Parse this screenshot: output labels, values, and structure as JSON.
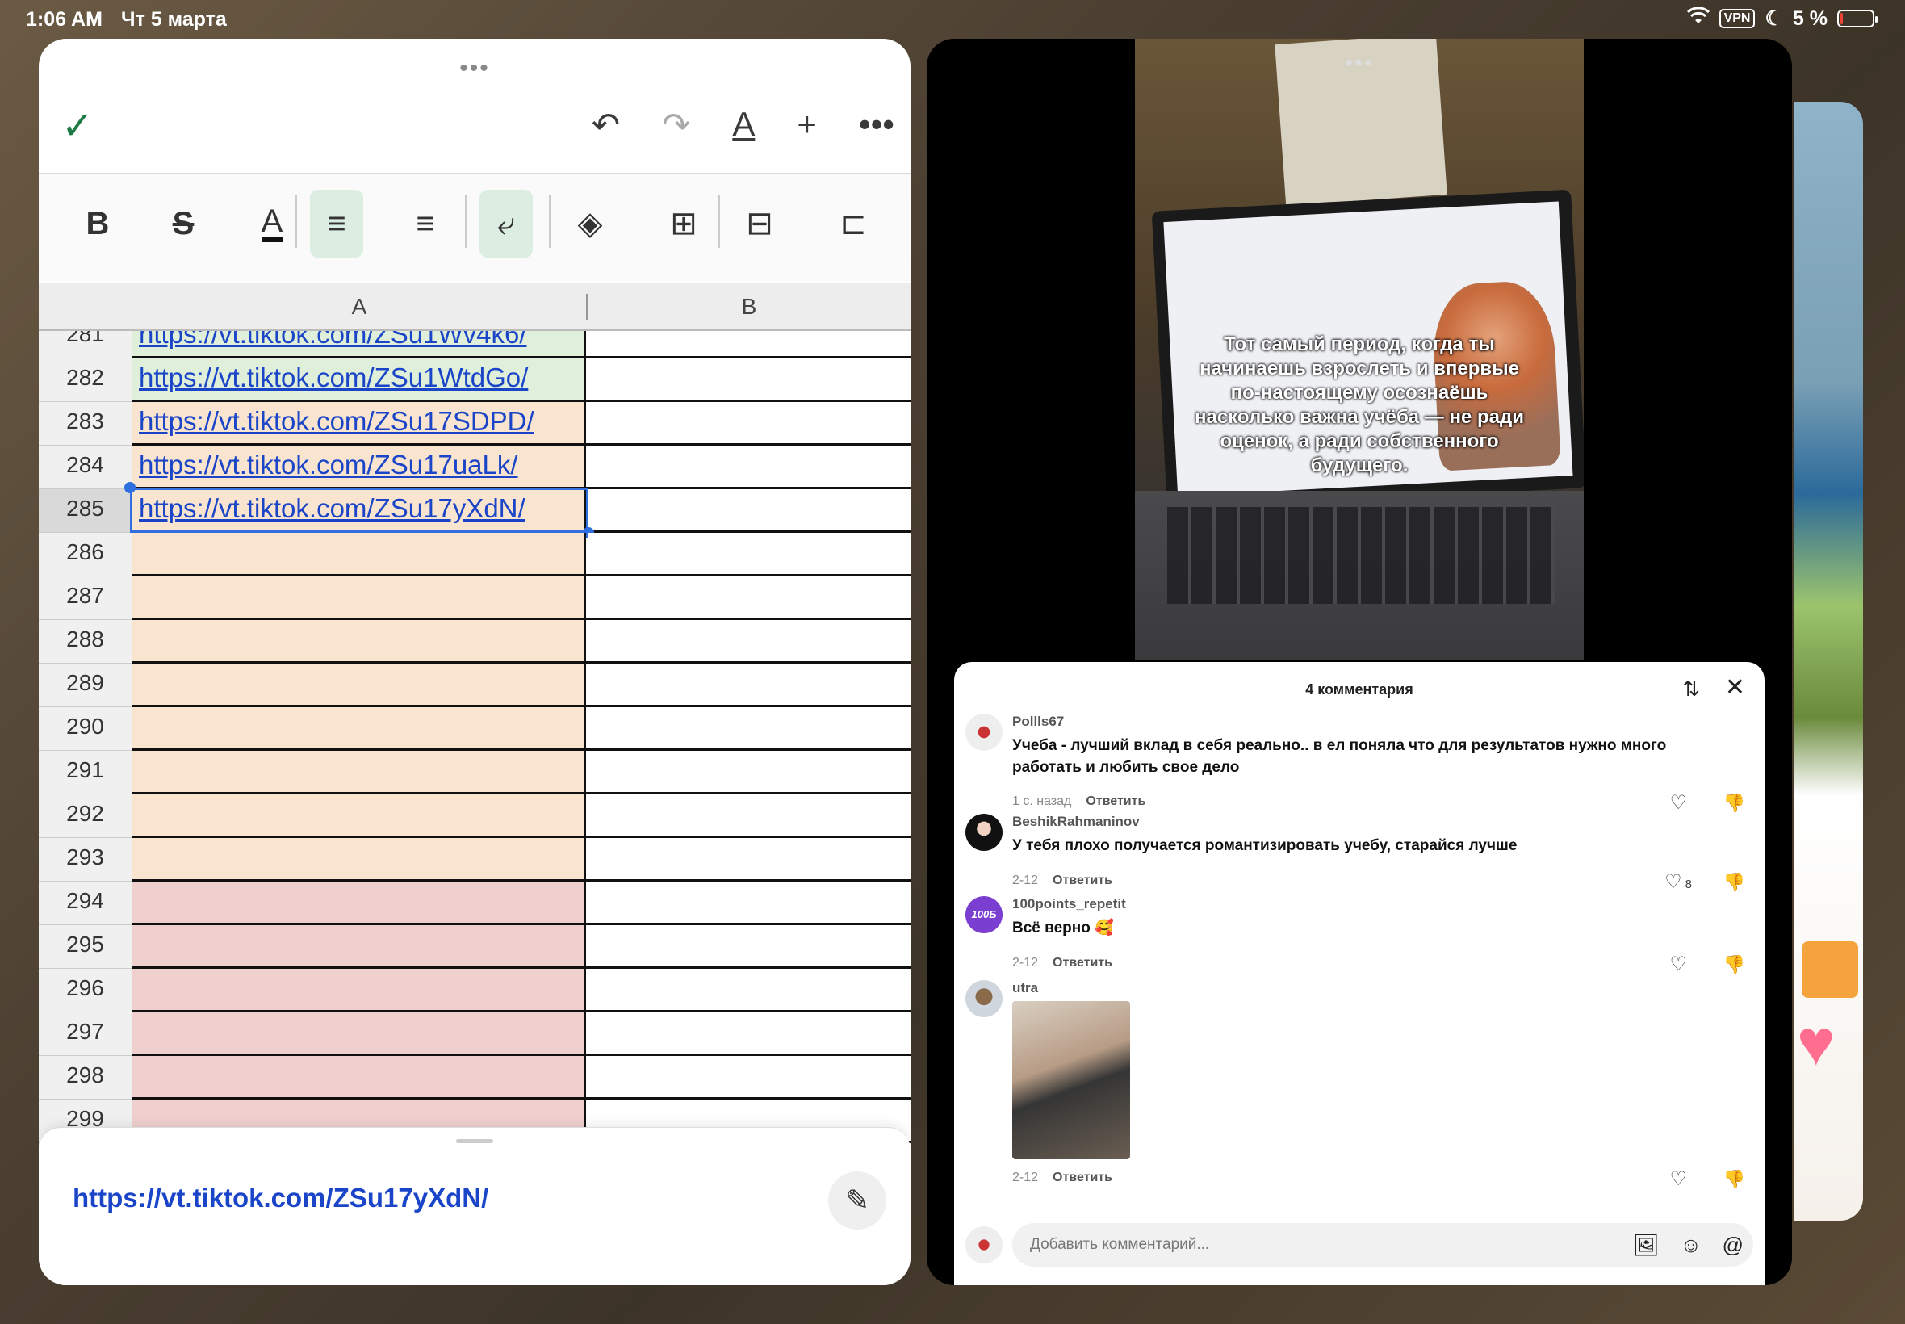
{
  "status_bar": {
    "time": "1:06 AM",
    "date": "Чт 5 марта",
    "vpn": "VPN",
    "battery": "5 %",
    "battery_level": 0.05
  },
  "sheet": {
    "grabber": "•••",
    "toolbar": {
      "done_icon": "checkmark-icon",
      "undo_icon": "undo-icon",
      "redo_icon": "redo-icon",
      "text_format_icon": "text-format-icon",
      "insert_icon": "plus-icon",
      "more_icon": "more-icon"
    },
    "columns": [
      "A",
      "B"
    ],
    "rows": [
      {
        "num": "281",
        "a": "https://vt.tiktok.com/ZSu1Wv4k6/",
        "fill": "green"
      },
      {
        "num": "282",
        "a": "https://vt.tiktok.com/ZSu1WtdGo/",
        "fill": "green"
      },
      {
        "num": "283",
        "a": "https://vt.tiktok.com/ZSu17SDPD/",
        "fill": "peach"
      },
      {
        "num": "284",
        "a": "https://vt.tiktok.com/ZSu17uaLk/",
        "fill": "peach"
      },
      {
        "num": "285",
        "a": "https://vt.tiktok.com/ZSu17yXdN/",
        "fill": "peach",
        "selected": true
      },
      {
        "num": "286",
        "a": "",
        "fill": "peach"
      },
      {
        "num": "287",
        "a": "",
        "fill": "peach"
      },
      {
        "num": "288",
        "a": "",
        "fill": "peach"
      },
      {
        "num": "289",
        "a": "",
        "fill": "peach"
      },
      {
        "num": "290",
        "a": "",
        "fill": "peach"
      },
      {
        "num": "291",
        "a": "",
        "fill": "peach"
      },
      {
        "num": "292",
        "a": "",
        "fill": "peach"
      },
      {
        "num": "293",
        "a": "",
        "fill": "peach"
      },
      {
        "num": "294",
        "a": "",
        "fill": "pink"
      },
      {
        "num": "295",
        "a": "",
        "fill": "pink"
      },
      {
        "num": "296",
        "a": "",
        "fill": "pink"
      },
      {
        "num": "297",
        "a": "",
        "fill": "pink"
      },
      {
        "num": "298",
        "a": "",
        "fill": "pink"
      },
      {
        "num": "299",
        "a": "",
        "fill": "pink"
      }
    ],
    "editor_value": "https://vt.tiktok.com/ZSu17yXdN/",
    "colors": {
      "green": "#dfefd9",
      "peach": "#f8e4cf",
      "pink": "#efd0cf",
      "link": "#1a45c8",
      "accent": "#1e7a45"
    }
  },
  "tiktok": {
    "grabber": "•••",
    "caption": "Тот самый период, когда ты начинаешь взрослеть и впервые по-настоящему осознаёшь насколько важна учёба — не ради оценок, а ради собственного будущего.",
    "comments_header": "4 комментария",
    "comments": [
      {
        "user": "Pollls67",
        "text": "Учеба - лучший вклад в себя реально.. в ел поняла что для результатов нужно много работать и любить свое дело",
        "time": "1 с. назад",
        "reply": "Ответить",
        "likes": ""
      },
      {
        "user": "BeshikRahmaninov",
        "text": "У тебя плохо получается романтизировать учебу, старайся лучше",
        "time": "2-12",
        "reply": "Ответить",
        "likes": "8"
      },
      {
        "user": "100points_repetit",
        "text": "Всё верно 🥰",
        "time": "2-12",
        "reply": "Ответить",
        "likes": "",
        "avatar_text": "100Б"
      },
      {
        "user": "utra",
        "text": "",
        "time": "2-12",
        "reply": "Ответить",
        "likes": ""
      }
    ],
    "input_placeholder": "Добавить комментарий..."
  }
}
